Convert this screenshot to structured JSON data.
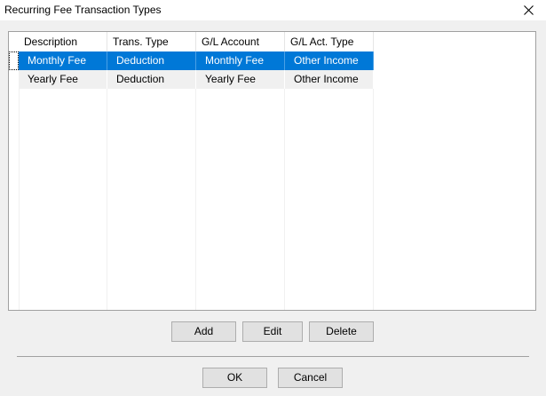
{
  "window": {
    "title": "Recurring Fee Transaction Types",
    "close_icon": "close-icon"
  },
  "grid": {
    "columns": [
      "Description",
      "Trans. Type",
      "G/L Account",
      "G/L Act. Type"
    ],
    "rows": [
      [
        "Monthly Fee",
        "Deduction",
        "Monthly Fee",
        "Other Income"
      ],
      [
        "Yearly Fee",
        "Deduction",
        "Yearly Fee",
        "Other Income"
      ]
    ],
    "selected_row": 0
  },
  "actions": {
    "add_label": "Add",
    "edit_label": "Edit",
    "delete_label": "Delete"
  },
  "footer": {
    "ok_label": "OK",
    "cancel_label": "Cancel"
  },
  "colors": {
    "selection": "#0078d7",
    "dialog_bg": "#f0f0f0",
    "button_bg": "#e1e1e1"
  }
}
